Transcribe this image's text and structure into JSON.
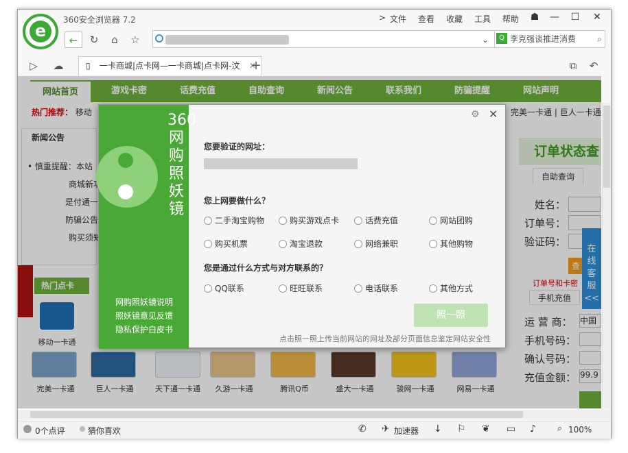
{
  "browser": {
    "title": "360安全浏览器 7.2",
    "menu": [
      "文件",
      "查看",
      "收藏",
      "工具",
      "帮助"
    ],
    "search_text": "李克强谈推进消费"
  },
  "tab": {
    "label": "一卡商城|点卡网—一卡商城|点卡网-汶"
  },
  "site_nav": [
    "网站首页",
    "游戏卡密",
    "话费充值",
    "自助查询",
    "新闻公告",
    "联系我们",
    "防骗提醒",
    "网站声明"
  ],
  "hot": {
    "label": "热门推荐：",
    "items": [
      "移动",
      "完美一卡通",
      "巨人一卡通"
    ]
  },
  "news": {
    "title": "新闻公告",
    "items": [
      "慎重提醒：本站",
      "商城新功",
      "是付通一",
      "防骗公告",
      "购买须知"
    ]
  },
  "order": {
    "title": "订单状态查",
    "tab": "自助查询",
    "name": "姓名：",
    "order_no": "订单号：",
    "code": "验证码：",
    "query": "查",
    "hint": "订单号和卡密"
  },
  "online": {
    "label": "在线客服",
    "arrow": "<<"
  },
  "phone": {
    "title": "手机充值",
    "operator": "运 营 商：",
    "operator_val": "中国",
    "phone": "手机号码：",
    "confirm": "确认号码：",
    "amount": "充值金额：",
    "amount_val": "99.9"
  },
  "hot_cards": {
    "title": "热门点卡"
  },
  "products": [
    "完美一卡通",
    "巨人一卡通",
    "天下通一卡通",
    "久游一卡通",
    "腾讯Q币",
    "盛大一卡通",
    "骏网一卡通",
    "网易一卡通"
  ],
  "top_product": "移动一卡通",
  "dialog": {
    "vertical_title": "360网购照妖镜",
    "links": [
      "网购照妖镜说明",
      "照妖镜意见反馈",
      "隐私保护白皮书"
    ],
    "q1": "您要验证的网址：",
    "q2": "您上网要做什么？",
    "q2_opts": [
      "二手淘宝购物",
      "购买游戏点卡",
      "话费充值",
      "网站团购",
      "购买机票",
      "淘宝退款",
      "网络兼职",
      "其他购物"
    ],
    "q3": "您是通过什么方式与对方联系的？",
    "q3_opts": [
      "QQ联系",
      "旺旺联系",
      "电话联系",
      "其他方式"
    ],
    "button": "照一照",
    "note": "点击照一照上传当前网站的网址及部分页面信息鉴定网站安全性"
  },
  "status": {
    "comments": "0个点评",
    "guess": "猜你喜欢",
    "accelerator": "加速器",
    "zoom": "100%"
  }
}
